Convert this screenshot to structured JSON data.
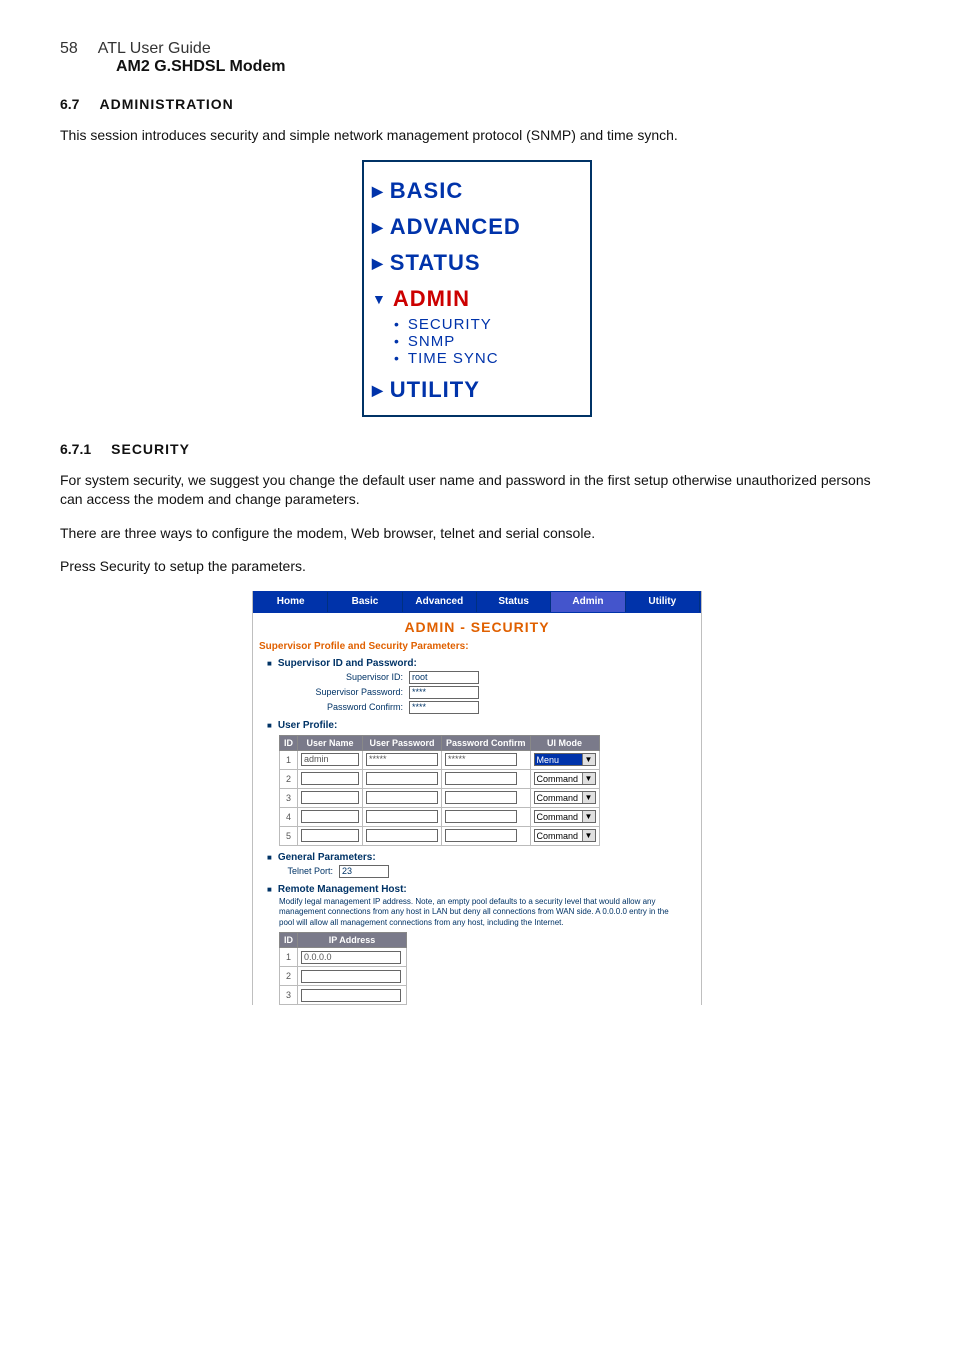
{
  "page": {
    "number": "58",
    "guide": "ATL User Guide",
    "product": "AM2 G.SHDSL Modem"
  },
  "section": {
    "num": "6.7",
    "title": "ADMINISTRATION",
    "intro": "This session introduces security and simple network management protocol (SNMP) and time synch."
  },
  "menu": {
    "basic": "BASIC",
    "advanced": "ADVANCED",
    "status": "STATUS",
    "admin": "ADMIN",
    "admin_items": [
      "SECURITY",
      "SNMP",
      "TIME SYNC"
    ],
    "utility": "UTILITY"
  },
  "subsection": {
    "num": "6.7.1",
    "title": "SECURITY",
    "p1": "For system security, we suggest you change the default user name and password in the first setup otherwise unauthorized persons can access the modem and change parameters.",
    "p2": "There are three ways to configure the modem, Web browser, telnet and serial console.",
    "p3": "Press Security to setup the parameters."
  },
  "scr2": {
    "tabs": [
      "Home",
      "Basic",
      "Advanced",
      "Status",
      "Admin",
      "Utility"
    ],
    "page_title": "ADMIN - SECURITY",
    "supervisor_header": "Supervisor Profile and Security Parameters:",
    "sec_idpw": "Supervisor ID and Password:",
    "labels": {
      "supervisor_id": "Supervisor ID:",
      "supervisor_pw": "Supervisor Password:",
      "pw_confirm": "Password Confirm:",
      "telnet_port": "Telnet Port:"
    },
    "values": {
      "supervisor_id": "root",
      "supervisor_pw": "****",
      "pw_confirm": "****",
      "telnet_port": "23",
      "remote_ip1": "0.0.0.0"
    },
    "user_profile_header": "User Profile:",
    "user_table": {
      "headers": [
        "ID",
        "User Name",
        "User Password",
        "Password Confirm",
        "UI Mode"
      ],
      "rows": [
        {
          "id": "1",
          "name": "admin",
          "pw": "*****",
          "confirm": "*****",
          "mode": "Menu",
          "hl": true
        },
        {
          "id": "2",
          "name": "",
          "pw": "",
          "confirm": "",
          "mode": "Command",
          "hl": false
        },
        {
          "id": "3",
          "name": "",
          "pw": "",
          "confirm": "",
          "mode": "Command",
          "hl": false
        },
        {
          "id": "4",
          "name": "",
          "pw": "",
          "confirm": "",
          "mode": "Command",
          "hl": false
        },
        {
          "id": "5",
          "name": "",
          "pw": "",
          "confirm": "",
          "mode": "Command",
          "hl": false
        }
      ]
    },
    "general_parameters_header": "General Parameters:",
    "remote_header": "Remote Management Host:",
    "remote_note": "Modify legal management IP address. Note, an empty pool defaults to a security level that would allow any management connections from any host in LAN but deny all connections from WAN side. A 0.0.0.0 entry in the pool will allow all management connections from any host, including the Internet.",
    "remote_table": {
      "headers": [
        "ID",
        "IP Address"
      ],
      "rows": [
        {
          "id": "1",
          "ip": "0.0.0.0"
        },
        {
          "id": "2",
          "ip": ""
        },
        {
          "id": "3",
          "ip": ""
        }
      ]
    }
  }
}
